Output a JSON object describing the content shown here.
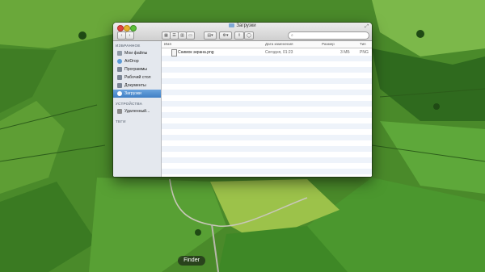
{
  "window": {
    "title": "Загрузки",
    "search_placeholder": ""
  },
  "sidebar": {
    "sections": [
      {
        "label": "ИЗБРАННОЕ"
      },
      {
        "label": "УСТРОЙСТВА"
      },
      {
        "label": "ТЕГИ"
      }
    ],
    "items": [
      {
        "label": "Мои файлы",
        "icon": "all-files-icon",
        "color": "#8f9aa6"
      },
      {
        "label": "AirDrop",
        "icon": "airdrop-icon",
        "color": "#5a9ad6"
      },
      {
        "label": "Программы",
        "icon": "applications-icon",
        "color": "#7a8594"
      },
      {
        "label": "Рабочий стол",
        "icon": "desktop-icon",
        "color": "#7a8594"
      },
      {
        "label": "Документы",
        "icon": "documents-icon",
        "color": "#7a8594"
      },
      {
        "label": "Загрузки",
        "icon": "downloads-icon",
        "color": "#ffffff",
        "selected": true
      }
    ],
    "devices": [
      {
        "label": "Удаленный...",
        "icon": "disk-icon",
        "color": "#8b8b8b"
      }
    ]
  },
  "columns": {
    "name": "Имя",
    "date": "Дата изменения",
    "size": "Размер",
    "kind": "Тип"
  },
  "files": [
    {
      "name": "Снимок экрана.png",
      "date": "Сегодня, 01:23",
      "size": "3 МБ",
      "kind": "PNG"
    }
  ],
  "dock": {
    "tooltip": "Finder"
  },
  "colors": {
    "selection": "#3f7fc4",
    "stripe": "#eef3fa"
  }
}
